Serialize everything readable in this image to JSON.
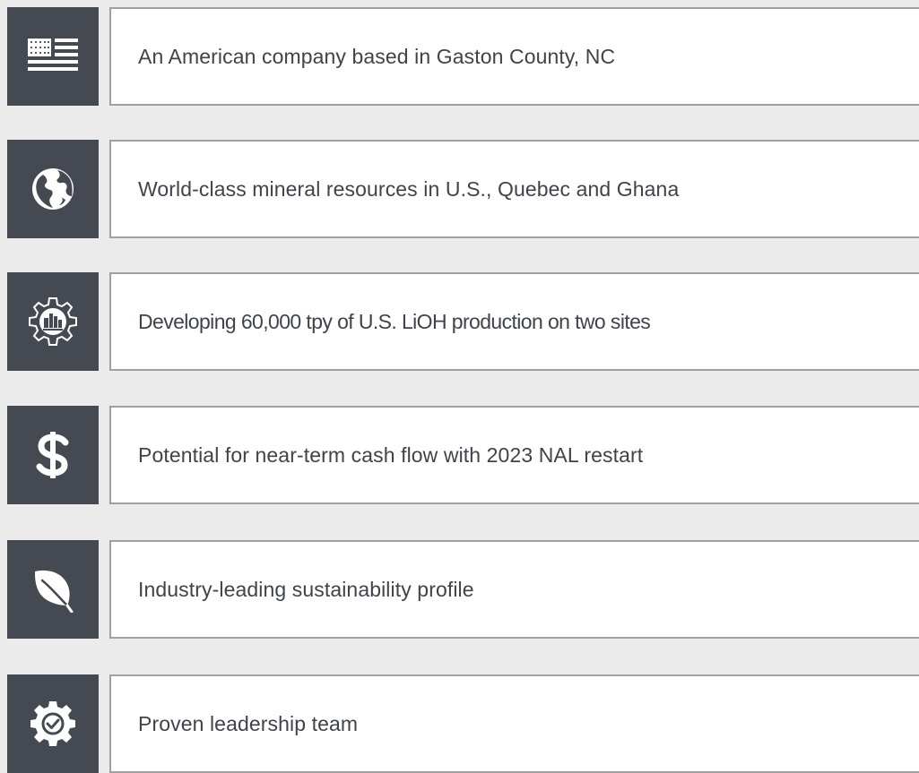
{
  "items": [
    {
      "icon": "flag-icon",
      "text": "An American company based in Gaston County, NC"
    },
    {
      "icon": "globe-icon",
      "text": "World-class mineral resources in U.S., Quebec and Ghana"
    },
    {
      "icon": "gear-factory-icon",
      "text": "Developing 60,000 tpy of U.S. LiOH production on two sites"
    },
    {
      "icon": "dollar-icon",
      "text": "Potential for near-term cash flow with 2023 NAL restart"
    },
    {
      "icon": "leaf-icon",
      "text": "Industry-leading sustainability profile"
    },
    {
      "icon": "gear-check-icon",
      "text": "Proven leadership team"
    }
  ],
  "colors": {
    "background": "#ebebeb",
    "tile": "#454a52",
    "card": "#ffffff",
    "border": "#9ea0a3",
    "text": "#3f434a"
  }
}
